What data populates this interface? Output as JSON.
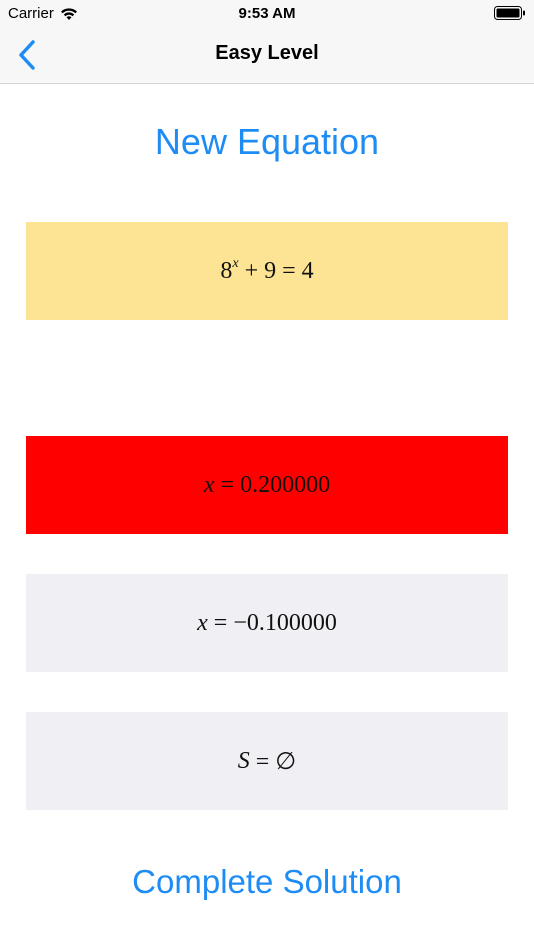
{
  "status_bar": {
    "carrier": "Carrier",
    "time": "9:53 AM"
  },
  "nav": {
    "title": "Easy Level"
  },
  "actions": {
    "new_equation": "New Equation",
    "complete_solution": "Complete Solution"
  },
  "equation": {
    "base": "8",
    "exponent": "x",
    "rest": " + 9 = 4"
  },
  "answers": [
    {
      "variable": "x",
      "rest": " = 0.200000"
    },
    {
      "variable": "x",
      "rest": " = −0.100000"
    },
    {
      "variable": "S",
      "rest": " = ∅"
    }
  ],
  "colors": {
    "accent": "#1e8cf5",
    "equation_bg": "#fde394",
    "selected_wrong_bg": "#ff0000",
    "option_bg": "#efeff4"
  }
}
